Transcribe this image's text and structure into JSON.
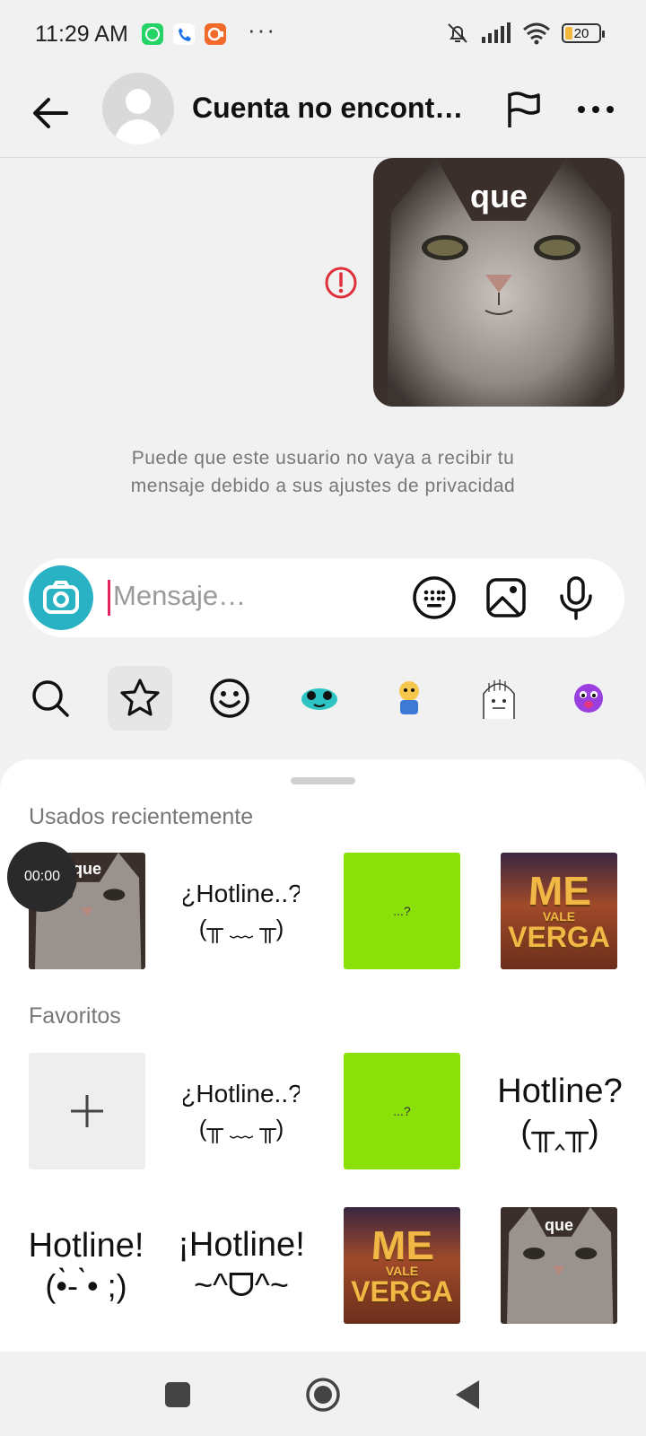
{
  "status_bar": {
    "time": "11:29 AM",
    "more_dots": "···",
    "battery": "20",
    "notification_icons": [
      "whatsapp-icon",
      "phone-app-icon",
      "video-app-icon"
    ],
    "right_icons": [
      "mute-bell-icon",
      "signal-icon",
      "wifi-icon",
      "battery-icon"
    ]
  },
  "header": {
    "title": "Cuenta no encont…",
    "icons": [
      "back-arrow-icon",
      "avatar-placeholder",
      "flag-icon",
      "more-icon"
    ]
  },
  "chat": {
    "sticker_caption": "que",
    "error_icon": "error-icon",
    "notice_line1": "Puede que este usuario no vaya a recibir tu",
    "notice_line2": "mensaje debido a sus ajustes de privacidad"
  },
  "composer": {
    "placeholder": "Mensaje…",
    "camera_color": "#29b2c3",
    "caret_color": "#e0245e",
    "buttons": [
      "keyboard-icon",
      "gallery-icon",
      "microphone-icon"
    ]
  },
  "sticker_tabs": [
    "search-icon",
    "star-icon",
    "emoji-icon",
    "sticker-pack-1",
    "sticker-pack-2",
    "sticker-pack-3",
    "sticker-pack-4"
  ],
  "sheet": {
    "recent_label": "Usados recientemente",
    "favorites_label": "Favoritos",
    "timer": "00:00",
    "recent": [
      {
        "type": "cat",
        "caption": "que"
      },
      {
        "type": "text",
        "line1": "¿Hotline..?",
        "line2": "(╥ ﹏ ╥)"
      },
      {
        "type": "green",
        "text": "...?"
      },
      {
        "type": "mvv",
        "me": "ME",
        "vale": "VALE",
        "verga": "VERGA"
      }
    ],
    "favorites": [
      {
        "type": "add"
      },
      {
        "type": "text",
        "line1": "¿Hotline..?",
        "line2": "(╥ ﹏ ╥)"
      },
      {
        "type": "green",
        "text": "...?"
      },
      {
        "type": "text",
        "line1": "Hotline?",
        "line2": "(╥‸╥)"
      },
      {
        "type": "text",
        "line1": "Hotline!",
        "line2": "(•̀- ̀•  ;)"
      },
      {
        "type": "text",
        "line1": "¡Hotline!",
        "line2": "~^ᗜ^~"
      },
      {
        "type": "mvv",
        "me": "ME",
        "vale": "VALE",
        "verga": "VERGA"
      },
      {
        "type": "cat",
        "caption": "que"
      }
    ]
  },
  "nav_bar": [
    "recents-button",
    "home-button",
    "back-button"
  ]
}
